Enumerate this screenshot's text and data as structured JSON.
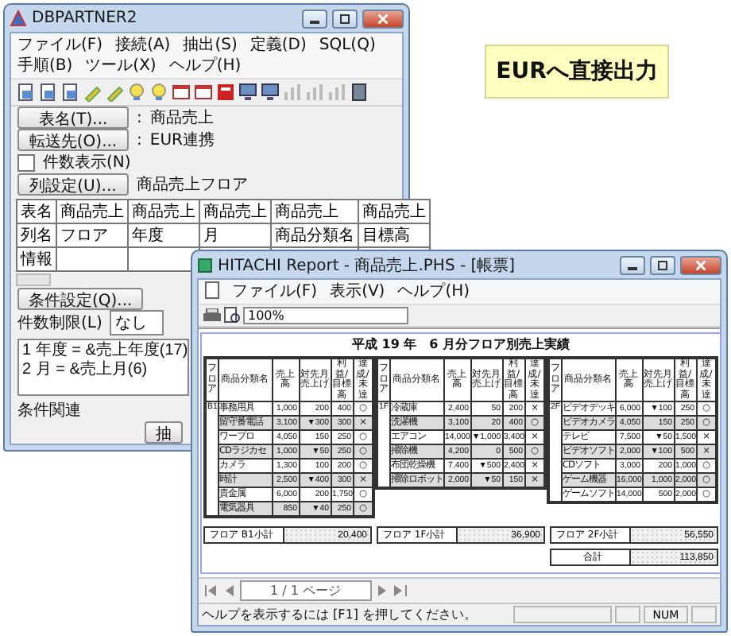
{
  "dbpartner": {
    "title": "DBPARTNER2",
    "menu": [
      "ファイル(F)",
      "接続(A)",
      "抽出(S)",
      "定義(D)",
      "SQL(Q)",
      "手順(B)",
      "ツール(X)",
      "ヘルプ(H)"
    ],
    "fields": [
      {
        "button": "表名(T)...",
        "separator": ":",
        "value": "商品売上"
      },
      {
        "button": "転送先(O)...",
        "separator": ":",
        "value": "EUR連携"
      }
    ],
    "count_display": {
      "label": "件数表示(N)",
      "checked": false
    },
    "column_button": "列設定(U)...",
    "column_value": "商品売上フロア",
    "grid": {
      "row_labels": [
        "表名",
        "列名",
        "情報"
      ],
      "columns": [
        {
          "table": "商品売上",
          "column": "フロア"
        },
        {
          "table": "商品売上",
          "column": "年度"
        },
        {
          "table": "商品売上",
          "column": "月"
        },
        {
          "table": "商品売上",
          "column": "商品分類名"
        },
        {
          "table": "商品売上",
          "column": "目標高"
        }
      ]
    },
    "condition_button": "条件設定(Q)...",
    "limit_label": "件数制限(L)",
    "limit_value": "なし",
    "conditions": [
      "1 年度 = &売上年度(17)",
      "2 月 = &売上月(6)"
    ],
    "relation_label": "条件関連",
    "extract_button": "抽"
  },
  "callout": "EURへ直接出力",
  "report": {
    "title": "HITACHI Report - 商品売上.PHS - [帳票]",
    "menu": [
      "ファイル(F)",
      "表示(V)",
      "ヘルプ(H)"
    ],
    "zoom": "100%",
    "heading": "平成 19 年　6 月分フロア別売上実績",
    "tables": [
      {
        "columns": [
          "フロア",
          "商品分類名",
          "売上高",
          "対先月売上げ",
          "利益/目標高",
          "達成/未達"
        ],
        "floor": "B1",
        "rows": [
          {
            "name": "事務用具",
            "sales": "1,000",
            "vs_last": "200",
            "profit": "400",
            "mark": "○"
          },
          {
            "name": "留守番電話",
            "sales": "3,100",
            "vs_last": "▼300",
            "profit": "300",
            "mark": "×"
          },
          {
            "name": "ワープロ",
            "sales": "4,050",
            "vs_last": "150",
            "profit": "250",
            "mark": "○"
          },
          {
            "name": "CDラジカセ",
            "sales": "1,000",
            "vs_last": "▼50",
            "profit": "250",
            "mark": "○"
          },
          {
            "name": "カメラ",
            "sales": "1,300",
            "vs_last": "100",
            "profit": "200",
            "mark": "○"
          },
          {
            "name": "時計",
            "sales": "2,500",
            "vs_last": "▼400",
            "profit": "300",
            "mark": "×"
          },
          {
            "name": "貴金属",
            "sales": "6,000",
            "vs_last": "200",
            "profit": "1,750",
            "mark": "○"
          },
          {
            "name": "電気器具",
            "sales": "850",
            "vs_last": "▼40",
            "profit": "250",
            "mark": "○"
          }
        ]
      },
      {
        "columns": [
          "フロア",
          "商品分類名",
          "売上高",
          "対先月売上げ",
          "利益/目標高",
          "達成/未達"
        ],
        "floor": "1F",
        "rows": [
          {
            "name": "冷蔵庫",
            "sales": "2,400",
            "vs_last": "50",
            "profit": "200",
            "mark": "×"
          },
          {
            "name": "洗濯機",
            "sales": "3,100",
            "vs_last": "20",
            "profit": "400",
            "mark": "○"
          },
          {
            "name": "エアコン",
            "sales": "14,000",
            "vs_last": "▼1,000",
            "profit": "3,400",
            "mark": "×"
          },
          {
            "name": "掃除機",
            "sales": "4,200",
            "vs_last": "0",
            "profit": "500",
            "mark": "○"
          },
          {
            "name": "布団乾燥機",
            "sales": "7,400",
            "vs_last": "▼500",
            "profit": "2,400",
            "mark": "×"
          },
          {
            "name": "掃除ロボット",
            "sales": "2,000",
            "vs_last": "▼50",
            "profit": "150",
            "mark": "×"
          }
        ]
      },
      {
        "columns": [
          "フロア",
          "商品分類名",
          "売上高",
          "対先月売上げ",
          "利益/目標高",
          "達成/未達"
        ],
        "floor": "2F",
        "rows": [
          {
            "name": "ビデオデッキ",
            "sales": "6,000",
            "vs_last": "▼100",
            "profit": "250",
            "mark": "○"
          },
          {
            "name": "ビデオカメラ",
            "sales": "4,050",
            "vs_last": "150",
            "profit": "250",
            "mark": "○"
          },
          {
            "name": "テレビ",
            "sales": "7,500",
            "vs_last": "▼50",
            "profit": "1,500",
            "mark": "×"
          },
          {
            "name": "ビデオソフト",
            "sales": "2,000",
            "vs_last": "▼100",
            "profit": "500",
            "mark": "×"
          },
          {
            "name": "CDソフト",
            "sales": "3,000",
            "vs_last": "200",
            "profit": "1,000",
            "mark": "○"
          },
          {
            "name": "ゲーム機器",
            "sales": "16,000",
            "vs_last": "1,000",
            "profit": "2,000",
            "mark": "○"
          },
          {
            "name": "ゲームソフト",
            "sales": "14,000",
            "vs_last": "500",
            "profit": "2,000",
            "mark": "○"
          }
        ]
      }
    ],
    "subtotals": [
      {
        "label": "フロア B1小計",
        "value": "20,400"
      },
      {
        "label": "フロア 1F小計",
        "value": "36,900"
      },
      {
        "label": "フロア 2F小計",
        "value": "56,550"
      }
    ],
    "total": {
      "label": "合計",
      "value": "113,850"
    },
    "pager": "1 / 1 ページ",
    "status": "ヘルプを表示するには [F1] を押してください。",
    "status_num": "NUM"
  }
}
